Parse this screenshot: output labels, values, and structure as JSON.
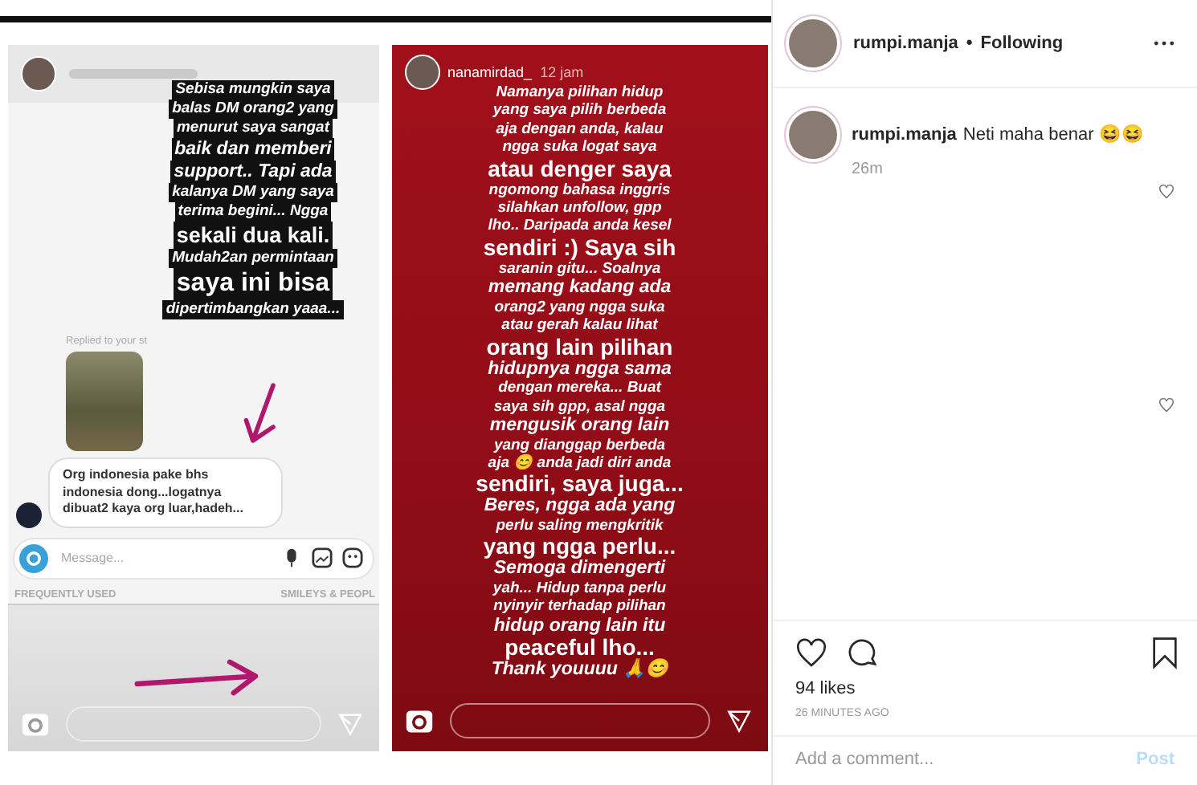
{
  "post_image": {
    "story_left": {
      "caption_lines": [
        {
          "text": "Sebisa mungkin saya",
          "kind": "small"
        },
        {
          "text": "balas DM orang2 yang",
          "kind": "small"
        },
        {
          "text": "menurut saya sangat",
          "kind": "small"
        },
        {
          "text": "baik dan memberi",
          "kind": "medium"
        },
        {
          "text": "support.. Tapi ada",
          "kind": "medium"
        },
        {
          "text": "kalanya DM yang saya",
          "kind": "small"
        },
        {
          "text": "terima begini... Ngga",
          "kind": "small"
        },
        {
          "text": "sekali dua kali.",
          "kind": "large"
        },
        {
          "text": "Mudah2an permintaan",
          "kind": "small"
        },
        {
          "text": "saya ini bisa",
          "kind": "xlarge"
        },
        {
          "text": "dipertimbangkan yaaa...",
          "kind": "small"
        }
      ],
      "reply_label": "Replied to your st",
      "message": "Org indonesia pake bhs indonesia dong...logatnya dibuat2 kaya org luar,hadeh...",
      "message_placeholder": "Message...",
      "emoji_tabs": [
        "FREQUENTLY USED",
        "SMILEYS & PEOPL"
      ]
    },
    "story_right": {
      "username": "nanamirdad_",
      "time": "12 jam",
      "lines": [
        {
          "text": "Namanya pilihan hidup",
          "kind": "small"
        },
        {
          "text": "yang saya pilih berbeda",
          "kind": "small"
        },
        {
          "text": "aja dengan anda, kalau",
          "kind": "small"
        },
        {
          "text": "ngga suka logat saya",
          "kind": "small"
        },
        {
          "text": "atau denger saya",
          "kind": "large"
        },
        {
          "text": "ngomong bahasa inggris",
          "kind": "small"
        },
        {
          "text": "silahkan unfollow, gpp",
          "kind": "small"
        },
        {
          "text": "lho.. Daripada anda kesel",
          "kind": "small"
        },
        {
          "text": "sendiri :) Saya sih",
          "kind": "large"
        },
        {
          "text": "saranin gitu... Soalnya",
          "kind": "small"
        },
        {
          "text": "memang kadang ada",
          "kind": "medium"
        },
        {
          "text": "orang2 yang ngga suka",
          "kind": "small"
        },
        {
          "text": "atau gerah kalau lihat",
          "kind": "small"
        },
        {
          "text": "orang lain pilihan",
          "kind": "large"
        },
        {
          "text": "hidupnya ngga sama",
          "kind": "medium"
        },
        {
          "text": "dengan mereka... Buat",
          "kind": "small"
        },
        {
          "text": "saya sih gpp, asal ngga",
          "kind": "small"
        },
        {
          "text": "mengusik orang lain",
          "kind": "medium"
        },
        {
          "text": "yang dianggap berbeda",
          "kind": "small"
        },
        {
          "text": "aja 😊 anda jadi diri anda",
          "kind": "small"
        },
        {
          "text": "sendiri, saya juga...",
          "kind": "large"
        },
        {
          "text": "Beres, ngga ada yang",
          "kind": "medium"
        },
        {
          "text": "perlu saling mengkritik",
          "kind": "small"
        },
        {
          "text": "yang ngga perlu...",
          "kind": "large"
        },
        {
          "text": "Semoga dimengerti",
          "kind": "medium"
        },
        {
          "text": "yah... Hidup tanpa perlu",
          "kind": "small"
        },
        {
          "text": "nyinyir terhadap pilihan",
          "kind": "small"
        },
        {
          "text": "hidup orang lain itu",
          "kind": "medium"
        },
        {
          "text": "peaceful lho...",
          "kind": "large"
        },
        {
          "text": "Thank youuuu 🙏😊",
          "kind": "medium"
        }
      ]
    }
  },
  "header": {
    "username": "rumpi.manja",
    "separator": "•",
    "status": "Following"
  },
  "comments": [
    {
      "username": "rumpi.manja",
      "text": "Neti maha benar 😆😆",
      "time": "26m"
    }
  ],
  "likes": "94 likes",
  "posted": "26 MINUTES AGO",
  "comment_field": {
    "placeholder": "Add a comment...",
    "button": "Post",
    "disabled": true
  }
}
